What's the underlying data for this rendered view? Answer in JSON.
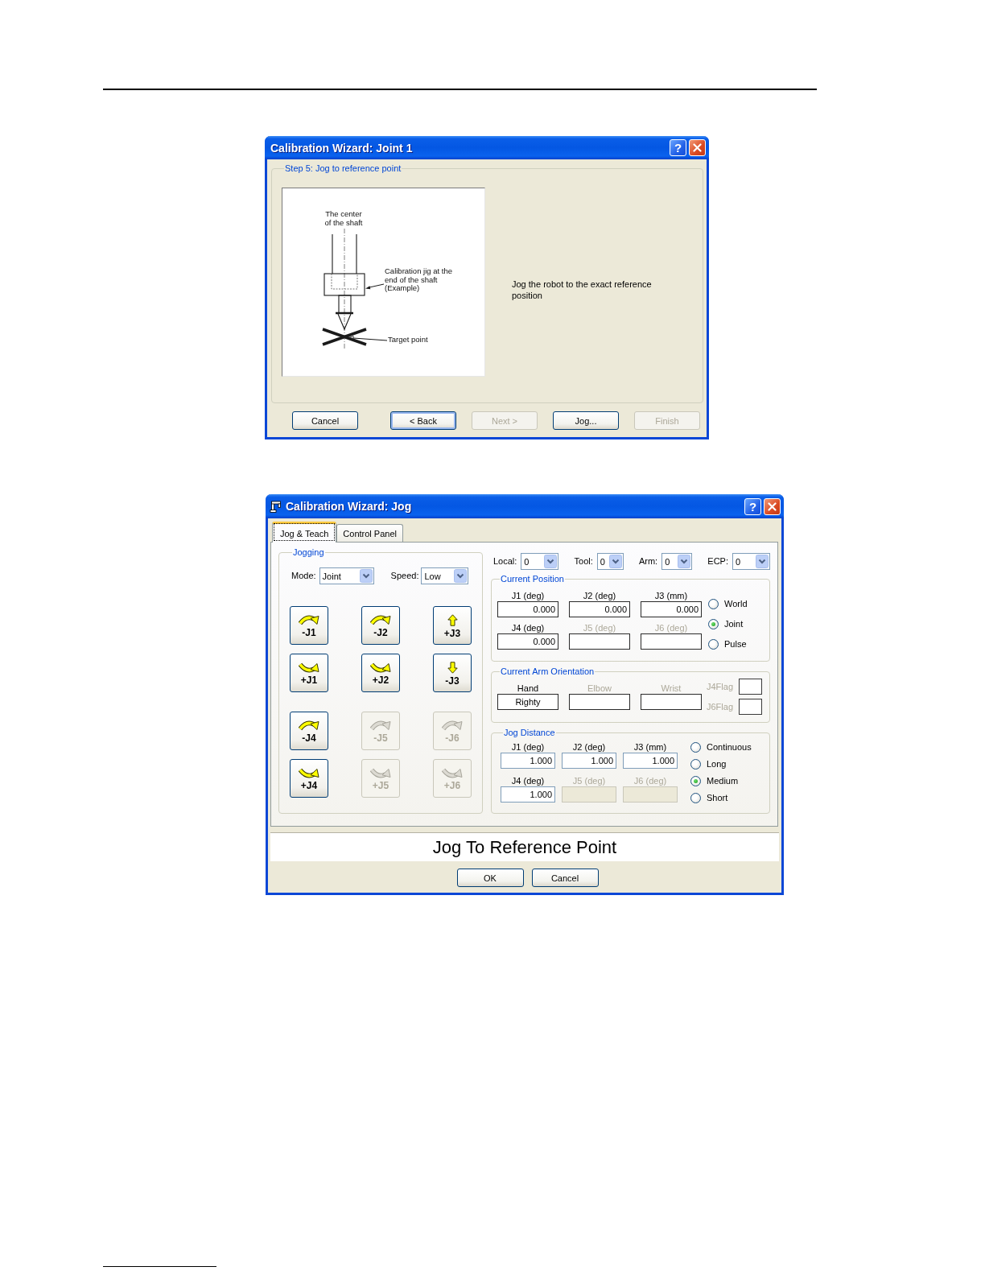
{
  "wizard_dialog": {
    "title": "Calibration Wizard: Joint 1",
    "title_icon": false,
    "help_button": "?",
    "step": {
      "legend": "Step 5: Jog to reference point",
      "diagram": {
        "center_label": "The center of the shaft",
        "jig_label": "Calibration jig at the end of the shaft (Example)",
        "target_label": "Target point"
      },
      "instruction": "Jog the robot to the exact reference position"
    },
    "buttons": [
      {
        "label": "Cancel",
        "disabled": false,
        "focused": false
      },
      {
        "label": "< Back",
        "disabled": false,
        "focused": true
      },
      {
        "label": "Next >",
        "disabled": true,
        "focused": false
      },
      {
        "label": "Jog...",
        "disabled": false,
        "focused": false
      },
      {
        "label": "Finish",
        "disabled": true,
        "focused": false
      }
    ]
  },
  "jog_dialog": {
    "title": "Calibration Wizard: Jog",
    "title_icon": true,
    "help_button": "?",
    "tabs": [
      {
        "label": "Jog & Teach",
        "selected": true
      },
      {
        "label": "Control Panel",
        "selected": false
      }
    ],
    "jogging": {
      "legend": "Jogging",
      "mode": {
        "label": "Mode:",
        "value": "Joint"
      },
      "speed": {
        "label": "Speed:",
        "value": "Low"
      },
      "button_groups": [
        [
          {
            "label": "-J1",
            "kind": "arc-over",
            "disabled": false
          },
          {
            "label": "-J2",
            "kind": "arc-over",
            "disabled": false
          },
          {
            "label": "+J3",
            "kind": "up",
            "disabled": false
          },
          {
            "label": "+J1",
            "kind": "arc-under",
            "disabled": false
          },
          {
            "label": "+J2",
            "kind": "arc-under",
            "disabled": false
          },
          {
            "label": "-J3",
            "kind": "down",
            "disabled": false
          }
        ],
        [
          {
            "label": "-J4",
            "kind": "arc-over",
            "disabled": false
          },
          {
            "label": "-J5",
            "kind": "arc-over",
            "disabled": true
          },
          {
            "label": "-J6",
            "kind": "arc-over",
            "disabled": true
          },
          {
            "label": "+J4",
            "kind": "arc-under",
            "disabled": false
          },
          {
            "label": "+J5",
            "kind": "arc-under",
            "disabled": true
          },
          {
            "label": "+J6",
            "kind": "arc-under",
            "disabled": true
          }
        ]
      ]
    },
    "selectors": [
      {
        "label": "Local:",
        "value": "0"
      },
      {
        "label": "Tool:",
        "value": "0"
      },
      {
        "label": "Arm:",
        "value": "0"
      },
      {
        "label": "ECP:",
        "value": "0"
      }
    ],
    "current_position": {
      "legend": "Current Position",
      "fields": [
        {
          "label": "J1 (deg)",
          "value": "0.000",
          "disabled": false
        },
        {
          "label": "J2 (deg)",
          "value": "0.000",
          "disabled": false
        },
        {
          "label": "J3 (mm)",
          "value": "0.000",
          "disabled": false
        },
        {
          "label": "J4 (deg)",
          "value": "0.000",
          "disabled": false
        },
        {
          "label": "J5 (deg)",
          "disabled": true
        },
        {
          "label": "J6 (deg)",
          "disabled": true
        }
      ],
      "options": [
        {
          "label": "World",
          "selected": false
        },
        {
          "label": "Joint",
          "selected": true
        },
        {
          "label": "Pulse",
          "selected": false
        }
      ]
    },
    "arm_orientation": {
      "legend": "Current Arm Orientation",
      "fields": [
        {
          "label": "Hand",
          "value": "Righty",
          "disabled": false
        },
        {
          "label": "Elbow",
          "disabled": true
        },
        {
          "label": "Wrist",
          "disabled": true
        }
      ],
      "flags": [
        {
          "label": "J4Flag",
          "disabled": true
        },
        {
          "label": "J6Flag",
          "disabled": true
        }
      ]
    },
    "jog_distance": {
      "legend": "Jog Distance",
      "fields": [
        {
          "label": "J1 (deg)",
          "value": "1.000",
          "disabled": false
        },
        {
          "label": "J2 (deg)",
          "value": "1.000",
          "disabled": false
        },
        {
          "label": "J3 (mm)",
          "value": "1.000",
          "disabled": false
        },
        {
          "label": "J4 (deg)",
          "value": "1.000",
          "disabled": false
        },
        {
          "label": "J5 (deg)",
          "disabled": true
        },
        {
          "label": "J6 (deg)",
          "disabled": true
        }
      ],
      "options": [
        {
          "label": "Continuous",
          "selected": false
        },
        {
          "label": "Long",
          "selected": false
        },
        {
          "label": "Medium",
          "selected": true
        },
        {
          "label": "Short",
          "selected": false
        }
      ]
    },
    "status_text": "Jog To Reference Point",
    "buttons": [
      {
        "label": "OK",
        "disabled": false,
        "focused": false
      },
      {
        "label": "Cancel",
        "disabled": false,
        "focused": false
      }
    ]
  }
}
